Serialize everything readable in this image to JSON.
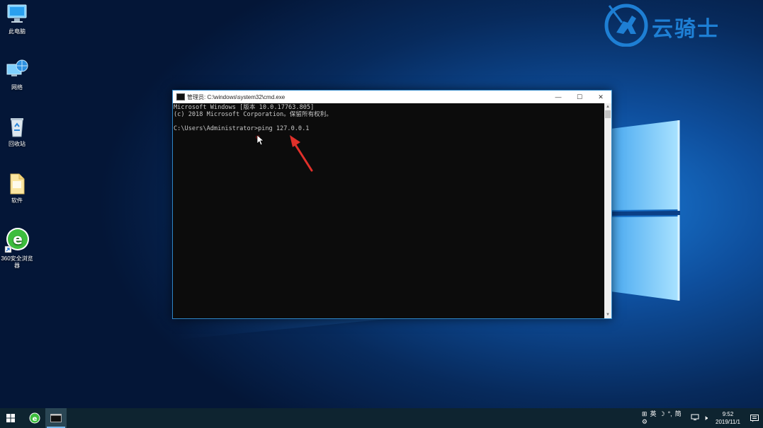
{
  "desktop": {
    "icons": [
      {
        "label": "此电脑",
        "icon": "this-pc-icon"
      },
      {
        "label": "网络",
        "icon": "network-icon"
      },
      {
        "label": "回收站",
        "icon": "recycle-bin-icon"
      },
      {
        "label": "软件",
        "icon": "folder-icon"
      },
      {
        "label": "360安全浏览器",
        "icon": "360-browser-icon"
      }
    ]
  },
  "watermark": {
    "text": "云骑士",
    "color": "#1e7fd4"
  },
  "cmd": {
    "title": "管理员: C:\\windows\\system32\\cmd.exe",
    "minimize": "—",
    "maximize": "☐",
    "close": "✕",
    "lines": [
      "Microsoft Windows [版本 10.0.17763.805]",
      "(c) 2018 Microsoft Corporation。保留所有权利。",
      "",
      "C:\\Users\\Administrator>ping 127.0.0.1"
    ]
  },
  "taskbar": {
    "items": [
      {
        "icon": "windows-start-icon"
      },
      {
        "icon": "360-browser-taskbar-icon"
      },
      {
        "icon": "cmd-taskbar-icon",
        "active": true
      }
    ],
    "tray": {
      "ime_lang": "英",
      "ime_mode": "简",
      "time": "9:52",
      "date": "2019/11/1"
    }
  },
  "colors": {
    "accent": "#2e86c7",
    "annotation": "#e0302a",
    "taskbar": "#0e2430"
  }
}
